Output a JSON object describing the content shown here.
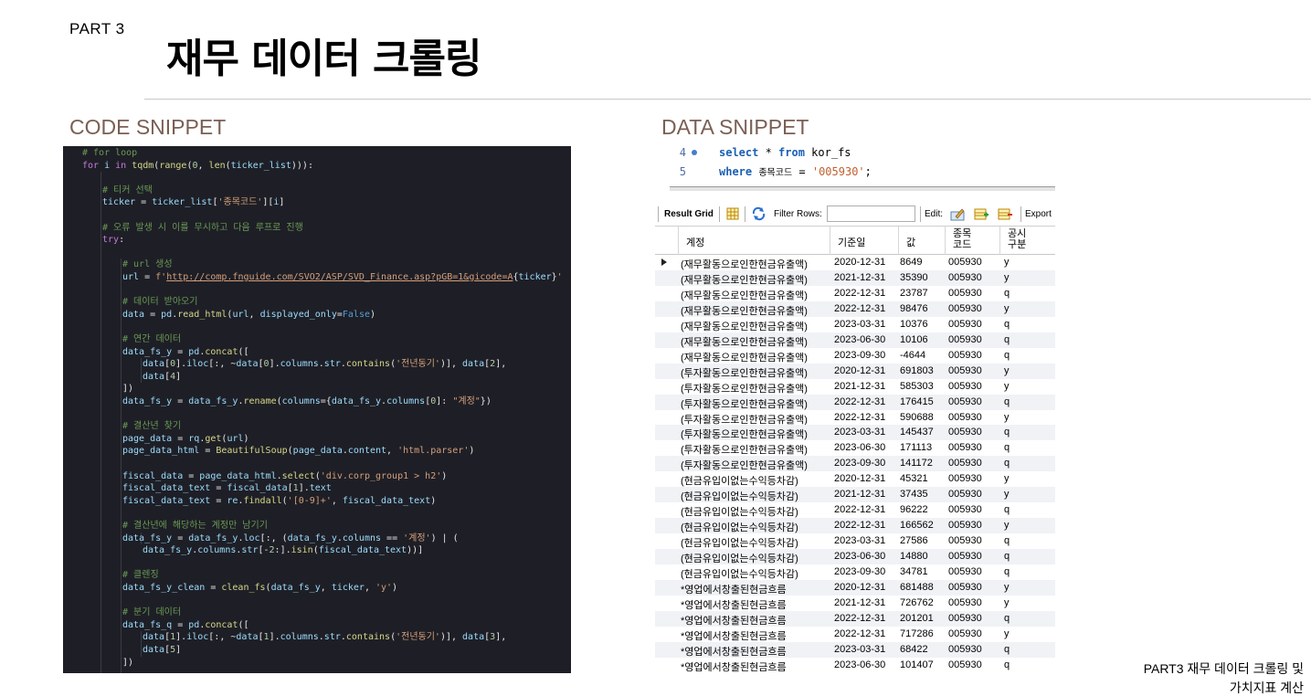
{
  "page": {
    "part_label": "PART 3",
    "title": "재무 데이터 크롤링",
    "code_section_title": "CODE SNIPPET",
    "data_section_title": "DATA SNIPPET",
    "footer_line1": "PART3 재무 데이터 크롤링 및",
    "footer_line2": "가치지표 계산"
  },
  "code_lines": [
    {
      "indent": 1,
      "tokens": [
        [
          "cm",
          "# for loop"
        ]
      ]
    },
    {
      "indent": 1,
      "tokens": [
        [
          "kw",
          "for "
        ],
        [
          "var",
          "i "
        ],
        [
          "kw",
          "in "
        ],
        [
          "fn",
          "tqdm"
        ],
        [
          "pl",
          "("
        ],
        [
          "fn",
          "range"
        ],
        [
          "pl",
          "("
        ],
        [
          "num",
          "0"
        ],
        [
          "pl",
          ", "
        ],
        [
          "fn",
          "len"
        ],
        [
          "pl",
          "("
        ],
        [
          "var",
          "ticker_list"
        ],
        [
          "pl",
          ")))"
        ],
        [
          "pl",
          ":"
        ]
      ]
    },
    {
      "indent": 0,
      "tokens": []
    },
    {
      "indent": 2,
      "tokens": [
        [
          "cm",
          "# 티커 선택"
        ]
      ]
    },
    {
      "indent": 2,
      "tokens": [
        [
          "var",
          "ticker "
        ],
        [
          "pl",
          "= "
        ],
        [
          "var",
          "ticker_list"
        ],
        [
          "pl",
          "["
        ],
        [
          "str",
          "'종목코드'"
        ],
        [
          "pl",
          "]["
        ],
        [
          "var",
          "i"
        ],
        [
          "pl",
          "]"
        ]
      ]
    },
    {
      "indent": 0,
      "tokens": []
    },
    {
      "indent": 2,
      "tokens": [
        [
          "cm",
          "# 오류 발생 시 이를 무시하고 다음 루프로 진행"
        ]
      ]
    },
    {
      "indent": 2,
      "tokens": [
        [
          "kw",
          "try"
        ],
        [
          "pl",
          ":"
        ]
      ]
    },
    {
      "indent": 0,
      "tokens": []
    },
    {
      "indent": 3,
      "tokens": [
        [
          "cm",
          "# url 생성"
        ]
      ]
    },
    {
      "indent": 3,
      "tokens": [
        [
          "var",
          "url "
        ],
        [
          "pl",
          "= "
        ],
        [
          "str",
          "f'"
        ],
        [
          "url",
          "http://comp.fnguide.com/SVO2/ASP/SVD_Finance.asp?pGB=1&gicode=A"
        ],
        [
          "pl",
          "{"
        ],
        [
          "var",
          "ticker"
        ],
        [
          "pl",
          "}"
        ],
        [
          "str",
          "'"
        ]
      ]
    },
    {
      "indent": 0,
      "tokens": []
    },
    {
      "indent": 3,
      "tokens": [
        [
          "cm",
          "# 데이터 받아오기"
        ]
      ]
    },
    {
      "indent": 3,
      "tokens": [
        [
          "var",
          "data "
        ],
        [
          "pl",
          "= "
        ],
        [
          "var",
          "pd"
        ],
        [
          "pl",
          "."
        ],
        [
          "fn",
          "read_html"
        ],
        [
          "pl",
          "("
        ],
        [
          "var",
          "url"
        ],
        [
          "pl",
          ", "
        ],
        [
          "var",
          "displayed_only"
        ],
        [
          "pl",
          "="
        ],
        [
          "bool",
          "False"
        ],
        [
          "pl",
          ")"
        ]
      ]
    },
    {
      "indent": 0,
      "tokens": []
    },
    {
      "indent": 3,
      "tokens": [
        [
          "cm",
          "# 연간 데이터"
        ]
      ]
    },
    {
      "indent": 3,
      "tokens": [
        [
          "var",
          "data_fs_y "
        ],
        [
          "pl",
          "= "
        ],
        [
          "var",
          "pd"
        ],
        [
          "pl",
          "."
        ],
        [
          "fn",
          "concat"
        ],
        [
          "pl",
          "(["
        ]
      ]
    },
    {
      "indent": 4,
      "tokens": [
        [
          "var",
          "data"
        ],
        [
          "pl",
          "["
        ],
        [
          "num",
          "0"
        ],
        [
          "pl",
          "]."
        ],
        [
          "var",
          "iloc"
        ],
        [
          "pl",
          "[:, ~"
        ],
        [
          "var",
          "data"
        ],
        [
          "pl",
          "["
        ],
        [
          "num",
          "0"
        ],
        [
          "pl",
          "]."
        ],
        [
          "var",
          "columns"
        ],
        [
          "pl",
          "."
        ],
        [
          "var",
          "str"
        ],
        [
          "pl",
          "."
        ],
        [
          "fn",
          "contains"
        ],
        [
          "pl",
          "("
        ],
        [
          "str",
          "'전년동기'"
        ],
        [
          "pl",
          ")], "
        ],
        [
          "var",
          "data"
        ],
        [
          "pl",
          "["
        ],
        [
          "num",
          "2"
        ],
        [
          "pl",
          "],"
        ]
      ]
    },
    {
      "indent": 4,
      "tokens": [
        [
          "var",
          "data"
        ],
        [
          "pl",
          "["
        ],
        [
          "num",
          "4"
        ],
        [
          "pl",
          "]"
        ]
      ]
    },
    {
      "indent": 3,
      "tokens": [
        [
          "pl",
          "])"
        ]
      ]
    },
    {
      "indent": 3,
      "tokens": [
        [
          "var",
          "data_fs_y "
        ],
        [
          "pl",
          "= "
        ],
        [
          "var",
          "data_fs_y"
        ],
        [
          "pl",
          "."
        ],
        [
          "fn",
          "rename"
        ],
        [
          "pl",
          "("
        ],
        [
          "var",
          "columns"
        ],
        [
          "pl",
          "={"
        ],
        [
          "var",
          "data_fs_y"
        ],
        [
          "pl",
          "."
        ],
        [
          "var",
          "columns"
        ],
        [
          "pl",
          "["
        ],
        [
          "num",
          "0"
        ],
        [
          "pl",
          "]: "
        ],
        [
          "str",
          "\"계정\""
        ],
        [
          "pl",
          "})"
        ]
      ]
    },
    {
      "indent": 0,
      "tokens": []
    },
    {
      "indent": 3,
      "tokens": [
        [
          "cm",
          "# 결산년 찾기"
        ]
      ]
    },
    {
      "indent": 3,
      "tokens": [
        [
          "var",
          "page_data "
        ],
        [
          "pl",
          "= "
        ],
        [
          "var",
          "rq"
        ],
        [
          "pl",
          "."
        ],
        [
          "fn",
          "get"
        ],
        [
          "pl",
          "("
        ],
        [
          "var",
          "url"
        ],
        [
          "pl",
          ")"
        ]
      ]
    },
    {
      "indent": 3,
      "tokens": [
        [
          "var",
          "page_data_html "
        ],
        [
          "pl",
          "= "
        ],
        [
          "fn",
          "BeautifulSoup"
        ],
        [
          "pl",
          "("
        ],
        [
          "var",
          "page_data"
        ],
        [
          "pl",
          "."
        ],
        [
          "var",
          "content"
        ],
        [
          "pl",
          ", "
        ],
        [
          "str",
          "'html.parser'"
        ],
        [
          "pl",
          ")"
        ]
      ]
    },
    {
      "indent": 0,
      "tokens": []
    },
    {
      "indent": 3,
      "tokens": [
        [
          "var",
          "fiscal_data "
        ],
        [
          "pl",
          "= "
        ],
        [
          "var",
          "page_data_html"
        ],
        [
          "pl",
          "."
        ],
        [
          "fn",
          "select"
        ],
        [
          "pl",
          "("
        ],
        [
          "str",
          "'div.corp_group1 > h2'"
        ],
        [
          "pl",
          ")"
        ]
      ]
    },
    {
      "indent": 3,
      "tokens": [
        [
          "var",
          "fiscal_data_text "
        ],
        [
          "pl",
          "= "
        ],
        [
          "var",
          "fiscal_data"
        ],
        [
          "pl",
          "["
        ],
        [
          "num",
          "1"
        ],
        [
          "pl",
          "]."
        ],
        [
          "var",
          "text"
        ]
      ]
    },
    {
      "indent": 3,
      "tokens": [
        [
          "var",
          "fiscal_data_text "
        ],
        [
          "pl",
          "= "
        ],
        [
          "var",
          "re"
        ],
        [
          "pl",
          "."
        ],
        [
          "fn",
          "findall"
        ],
        [
          "pl",
          "("
        ],
        [
          "str",
          "'[0-9]+'"
        ],
        [
          "pl",
          ", "
        ],
        [
          "var",
          "fiscal_data_text"
        ],
        [
          "pl",
          ")"
        ]
      ]
    },
    {
      "indent": 0,
      "tokens": []
    },
    {
      "indent": 3,
      "tokens": [
        [
          "cm",
          "# 결산년에 해당하는 계정만 남기기"
        ]
      ]
    },
    {
      "indent": 3,
      "tokens": [
        [
          "var",
          "data_fs_y "
        ],
        [
          "pl",
          "= "
        ],
        [
          "var",
          "data_fs_y"
        ],
        [
          "pl",
          "."
        ],
        [
          "var",
          "loc"
        ],
        [
          "pl",
          "[:, ("
        ],
        [
          "var",
          "data_fs_y"
        ],
        [
          "pl",
          "."
        ],
        [
          "var",
          "columns "
        ],
        [
          "pl",
          "== "
        ],
        [
          "str",
          "'계정'"
        ],
        [
          "pl",
          ") | ("
        ]
      ]
    },
    {
      "indent": 4,
      "tokens": [
        [
          "var",
          "data_fs_y"
        ],
        [
          "pl",
          "."
        ],
        [
          "var",
          "columns"
        ],
        [
          "pl",
          "."
        ],
        [
          "var",
          "str"
        ],
        [
          "pl",
          "[-"
        ],
        [
          "num",
          "2"
        ],
        [
          "pl",
          ":]."
        ],
        [
          "fn",
          "isin"
        ],
        [
          "pl",
          "("
        ],
        [
          "var",
          "fiscal_data_text"
        ],
        [
          "pl",
          "))]"
        ]
      ]
    },
    {
      "indent": 0,
      "tokens": []
    },
    {
      "indent": 3,
      "tokens": [
        [
          "cm",
          "# 클렌징"
        ]
      ]
    },
    {
      "indent": 3,
      "tokens": [
        [
          "var",
          "data_fs_y_clean "
        ],
        [
          "pl",
          "= "
        ],
        [
          "fn",
          "clean_fs"
        ],
        [
          "pl",
          "("
        ],
        [
          "var",
          "data_fs_y"
        ],
        [
          "pl",
          ", "
        ],
        [
          "var",
          "ticker"
        ],
        [
          "pl",
          ", "
        ],
        [
          "str",
          "'y'"
        ],
        [
          "pl",
          ")"
        ]
      ]
    },
    {
      "indent": 0,
      "tokens": []
    },
    {
      "indent": 3,
      "tokens": [
        [
          "cm",
          "# 분기 데이터"
        ]
      ]
    },
    {
      "indent": 3,
      "tokens": [
        [
          "var",
          "data_fs_q "
        ],
        [
          "pl",
          "= "
        ],
        [
          "var",
          "pd"
        ],
        [
          "pl",
          "."
        ],
        [
          "fn",
          "concat"
        ],
        [
          "pl",
          "(["
        ]
      ]
    },
    {
      "indent": 4,
      "tokens": [
        [
          "var",
          "data"
        ],
        [
          "pl",
          "["
        ],
        [
          "num",
          "1"
        ],
        [
          "pl",
          "]."
        ],
        [
          "var",
          "iloc"
        ],
        [
          "pl",
          "[:, ~"
        ],
        [
          "var",
          "data"
        ],
        [
          "pl",
          "["
        ],
        [
          "num",
          "1"
        ],
        [
          "pl",
          "]."
        ],
        [
          "var",
          "columns"
        ],
        [
          "pl",
          "."
        ],
        [
          "var",
          "str"
        ],
        [
          "pl",
          "."
        ],
        [
          "fn",
          "contains"
        ],
        [
          "pl",
          "("
        ],
        [
          "str",
          "'전년동기'"
        ],
        [
          "pl",
          ")], "
        ],
        [
          "var",
          "data"
        ],
        [
          "pl",
          "["
        ],
        [
          "num",
          "3"
        ],
        [
          "pl",
          "],"
        ]
      ]
    },
    {
      "indent": 4,
      "tokens": [
        [
          "var",
          "data"
        ],
        [
          "pl",
          "["
        ],
        [
          "num",
          "5"
        ],
        [
          "pl",
          "]"
        ]
      ]
    },
    {
      "indent": 3,
      "tokens": [
        [
          "pl",
          "])"
        ]
      ]
    }
  ],
  "sql": {
    "lines": [
      {
        "num": "4",
        "has_dot": true,
        "parts": [
          [
            "kw",
            "select"
          ],
          [
            "pl",
            " * "
          ],
          [
            "kw",
            "from"
          ],
          [
            "pl",
            " kor_fs"
          ]
        ]
      },
      {
        "num": "5",
        "has_dot": false,
        "parts": [
          [
            "kw",
            "where"
          ],
          [
            "pl",
            " "
          ],
          [
            "sm",
            "종목코드"
          ],
          [
            "pl",
            " = "
          ],
          [
            "str",
            "'005930'"
          ],
          [
            "pl",
            ";"
          ]
        ]
      }
    ]
  },
  "toolbar": {
    "result_grid": "Result Grid",
    "filter_rows": "Filter Rows:",
    "edit": "Edit:",
    "export": "Export"
  },
  "grid": {
    "headers": [
      "계정",
      "기준일",
      "값",
      "종목\n코드",
      "공시\n구분"
    ],
    "rows": [
      [
        "(재무활동으로인한현금유출액)",
        "2020-12-31",
        "8649",
        "005930",
        "y"
      ],
      [
        "(재무활동으로인한현금유출액)",
        "2021-12-31",
        "35390",
        "005930",
        "y"
      ],
      [
        "(재무활동으로인한현금유출액)",
        "2022-12-31",
        "23787",
        "005930",
        "q"
      ],
      [
        "(재무활동으로인한현금유출액)",
        "2022-12-31",
        "98476",
        "005930",
        "y"
      ],
      [
        "(재무활동으로인한현금유출액)",
        "2023-03-31",
        "10376",
        "005930",
        "q"
      ],
      [
        "(재무활동으로인한현금유출액)",
        "2023-06-30",
        "10106",
        "005930",
        "q"
      ],
      [
        "(재무활동으로인한현금유출액)",
        "2023-09-30",
        "-4644",
        "005930",
        "q"
      ],
      [
        "(투자활동으로인한현금유출액)",
        "2020-12-31",
        "691803",
        "005930",
        "y"
      ],
      [
        "(투자활동으로인한현금유출액)",
        "2021-12-31",
        "585303",
        "005930",
        "y"
      ],
      [
        "(투자활동으로인한현금유출액)",
        "2022-12-31",
        "176415",
        "005930",
        "q"
      ],
      [
        "(투자활동으로인한현금유출액)",
        "2022-12-31",
        "590688",
        "005930",
        "y"
      ],
      [
        "(투자활동으로인한현금유출액)",
        "2023-03-31",
        "145437",
        "005930",
        "q"
      ],
      [
        "(투자활동으로인한현금유출액)",
        "2023-06-30",
        "171113",
        "005930",
        "q"
      ],
      [
        "(투자활동으로인한현금유출액)",
        "2023-09-30",
        "141172",
        "005930",
        "q"
      ],
      [
        "(현금유입이없는수익등차감)",
        "2020-12-31",
        "45321",
        "005930",
        "y"
      ],
      [
        "(현금유입이없는수익등차감)",
        "2021-12-31",
        "37435",
        "005930",
        "y"
      ],
      [
        "(현금유입이없는수익등차감)",
        "2022-12-31",
        "96222",
        "005930",
        "q"
      ],
      [
        "(현금유입이없는수익등차감)",
        "2022-12-31",
        "166562",
        "005930",
        "y"
      ],
      [
        "(현금유입이없는수익등차감)",
        "2023-03-31",
        "27586",
        "005930",
        "q"
      ],
      [
        "(현금유입이없는수익등차감)",
        "2023-06-30",
        "14880",
        "005930",
        "q"
      ],
      [
        "(현금유입이없는수익등차감)",
        "2023-09-30",
        "34781",
        "005930",
        "q"
      ],
      [
        "*영업에서창출된현금흐름",
        "2020-12-31",
        "681488",
        "005930",
        "y"
      ],
      [
        "*영업에서창출된현금흐름",
        "2021-12-31",
        "726762",
        "005930",
        "y"
      ],
      [
        "*영업에서창출된현금흐름",
        "2022-12-31",
        "201201",
        "005930",
        "q"
      ],
      [
        "*영업에서창출된현금흐름",
        "2022-12-31",
        "717286",
        "005930",
        "y"
      ],
      [
        "*영업에서창출된현금흐름",
        "2023-03-31",
        "68422",
        "005930",
        "q"
      ],
      [
        "*영업에서창출된현금흐름",
        "2023-06-30",
        "101407",
        "005930",
        "q"
      ]
    ]
  }
}
